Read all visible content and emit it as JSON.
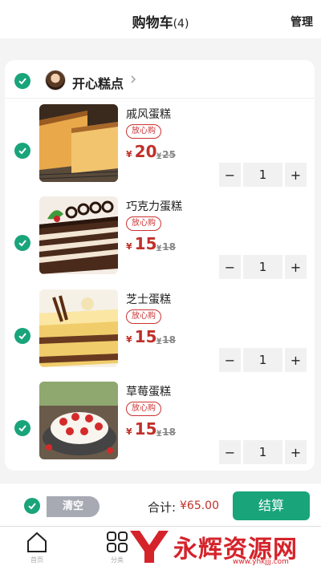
{
  "header": {
    "title": "购物车",
    "count": "(4)",
    "manage_label": "管理"
  },
  "store": {
    "name": "开心糕点"
  },
  "items": [
    {
      "name": "戚风蛋糕",
      "tag": "放心购",
      "currency": "¥",
      "price": "20",
      "original_price": "25"
    },
    {
      "name": "巧克力蛋糕",
      "tag": "放心购",
      "currency": "¥",
      "price": "15",
      "original_price": "18"
    },
    {
      "name": "芝士蛋糕",
      "tag": "放心购",
      "currency": "¥",
      "price": "15",
      "original_price": "18"
    },
    {
      "name": "草莓蛋糕",
      "tag": "放心购",
      "currency": "¥",
      "price": "15",
      "original_price": "18"
    }
  ],
  "stepper": {
    "minus": "−",
    "plus": "+",
    "quantities": [
      "1",
      "1",
      "1",
      "1"
    ]
  },
  "bottom": {
    "clear_label": "清空",
    "total_label": "合计:",
    "total_value": "¥65.00",
    "checkout_label": "结算"
  },
  "tabbar": {
    "tabs": [
      {
        "label": "首页",
        "icon": "home-icon"
      },
      {
        "label": "分类",
        "icon": "category-icon"
      }
    ]
  },
  "watermark": {
    "text": "永辉资源网",
    "url": "www.yhkjjj.com"
  },
  "colors": {
    "accent": "#19a47a",
    "price": "#c0302a",
    "tag": "#cc3333"
  }
}
